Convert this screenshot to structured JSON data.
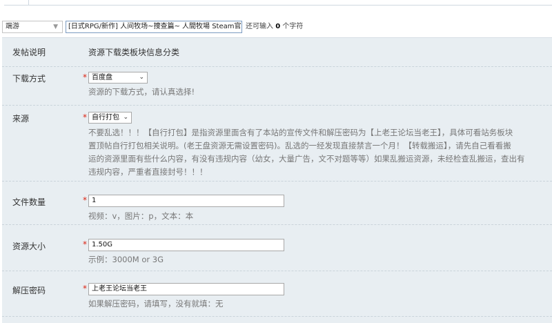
{
  "topbar": {
    "type_select": "端游",
    "title_value": "[日式RPG/新作] 人间牧场~捜查篇~ 人間牧場 Steam官中",
    "remain_prefix": "还可输入",
    "remain_count": "0",
    "remain_suffix": "个字符"
  },
  "form": {
    "description": {
      "label": "发帖说明",
      "value": "资源下载类板块信息分类"
    },
    "download_method": {
      "label": "下载方式",
      "required_mark": "*",
      "selected": "百度盘",
      "hint": "资源的下载方式，请认真选择!"
    },
    "source": {
      "label": "来源",
      "required_mark": "*",
      "selected": "自行打包",
      "hint_lines": [
        "不要乱选！！！【自行打包】是指资源里面含有了本站的宣传文件和解压密码为【上老王论坛当老王】，具体可看站务板块",
        "置顶帖自行打包相关说明。(老王盘资源无需设置密码)。乱选的一经发现直接禁言一个月！【转载搬运】，请先自己看看搬",
        "运的资源里面有些什么内容，有没有违规内容（幼女，大量广告，文不对题等等）如果乱搬运资源，未经检查乱搬运，查出有",
        "违规内容，严重者直接封号！！！"
      ]
    },
    "file_count": {
      "label": "文件数量",
      "required_mark": "*",
      "value": "1",
      "hint": "视频：v，图片：p，文本：本"
    },
    "resource_size": {
      "label": "资源大小",
      "required_mark": "*",
      "value": "1.50G",
      "hint": "示例：3000M or 3G"
    },
    "password": {
      "label": "解压密码",
      "required_mark": "*",
      "value": "上老王论坛当老王",
      "hint": "如果解压密码，请填写，没有就填：无"
    }
  },
  "icons": {
    "dropdown": "chevron-down-icon"
  },
  "colors": {
    "panel_bg": "#e8eef2",
    "required": "#dd2211",
    "hint_text": "#777777",
    "title_border": "#7a9ac0"
  }
}
